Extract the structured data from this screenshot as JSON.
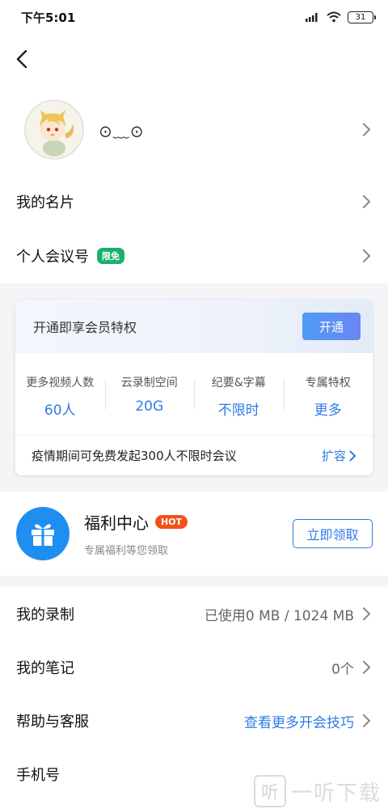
{
  "status_bar": {
    "time": "下午5:01",
    "battery": "31"
  },
  "profile": {
    "nickname": "⊙﹏⊙"
  },
  "menu_top": {
    "card_label": "我的名片",
    "meeting_label": "个人会议号",
    "meeting_badge": "限免"
  },
  "vip": {
    "title": "开通即享会员特权",
    "open_button": "开通",
    "stats": [
      {
        "label": "更多视频人数",
        "value": "60人"
      },
      {
        "label": "云录制空间",
        "value": "20G"
      },
      {
        "label": "纪要&字幕",
        "value": "不限时"
      },
      {
        "label": "专属特权",
        "value": "更多"
      }
    ],
    "promo_text": "疫情期间可免费发起300人不限时会议",
    "expand_label": "扩容"
  },
  "welfare": {
    "title": "福利中心",
    "badge": "HOT",
    "subtitle": "专属福利等您领取",
    "claim_button": "立即领取"
  },
  "list": {
    "recording_label": "我的录制",
    "recording_value": "已使用0 MB / 1024 MB",
    "notes_label": "我的笔记",
    "notes_value": "0个",
    "help_label": "帮助与客服",
    "help_value": "查看更多开会技巧",
    "phone_label": "手机号"
  },
  "watermark": {
    "glyph": "听",
    "text": "一听下载"
  },
  "colors": {
    "accent": "#2f7be4",
    "badge_green": "#1db06b",
    "badge_hot": "#f2511a",
    "gift_blue": "#1f8ef1"
  }
}
